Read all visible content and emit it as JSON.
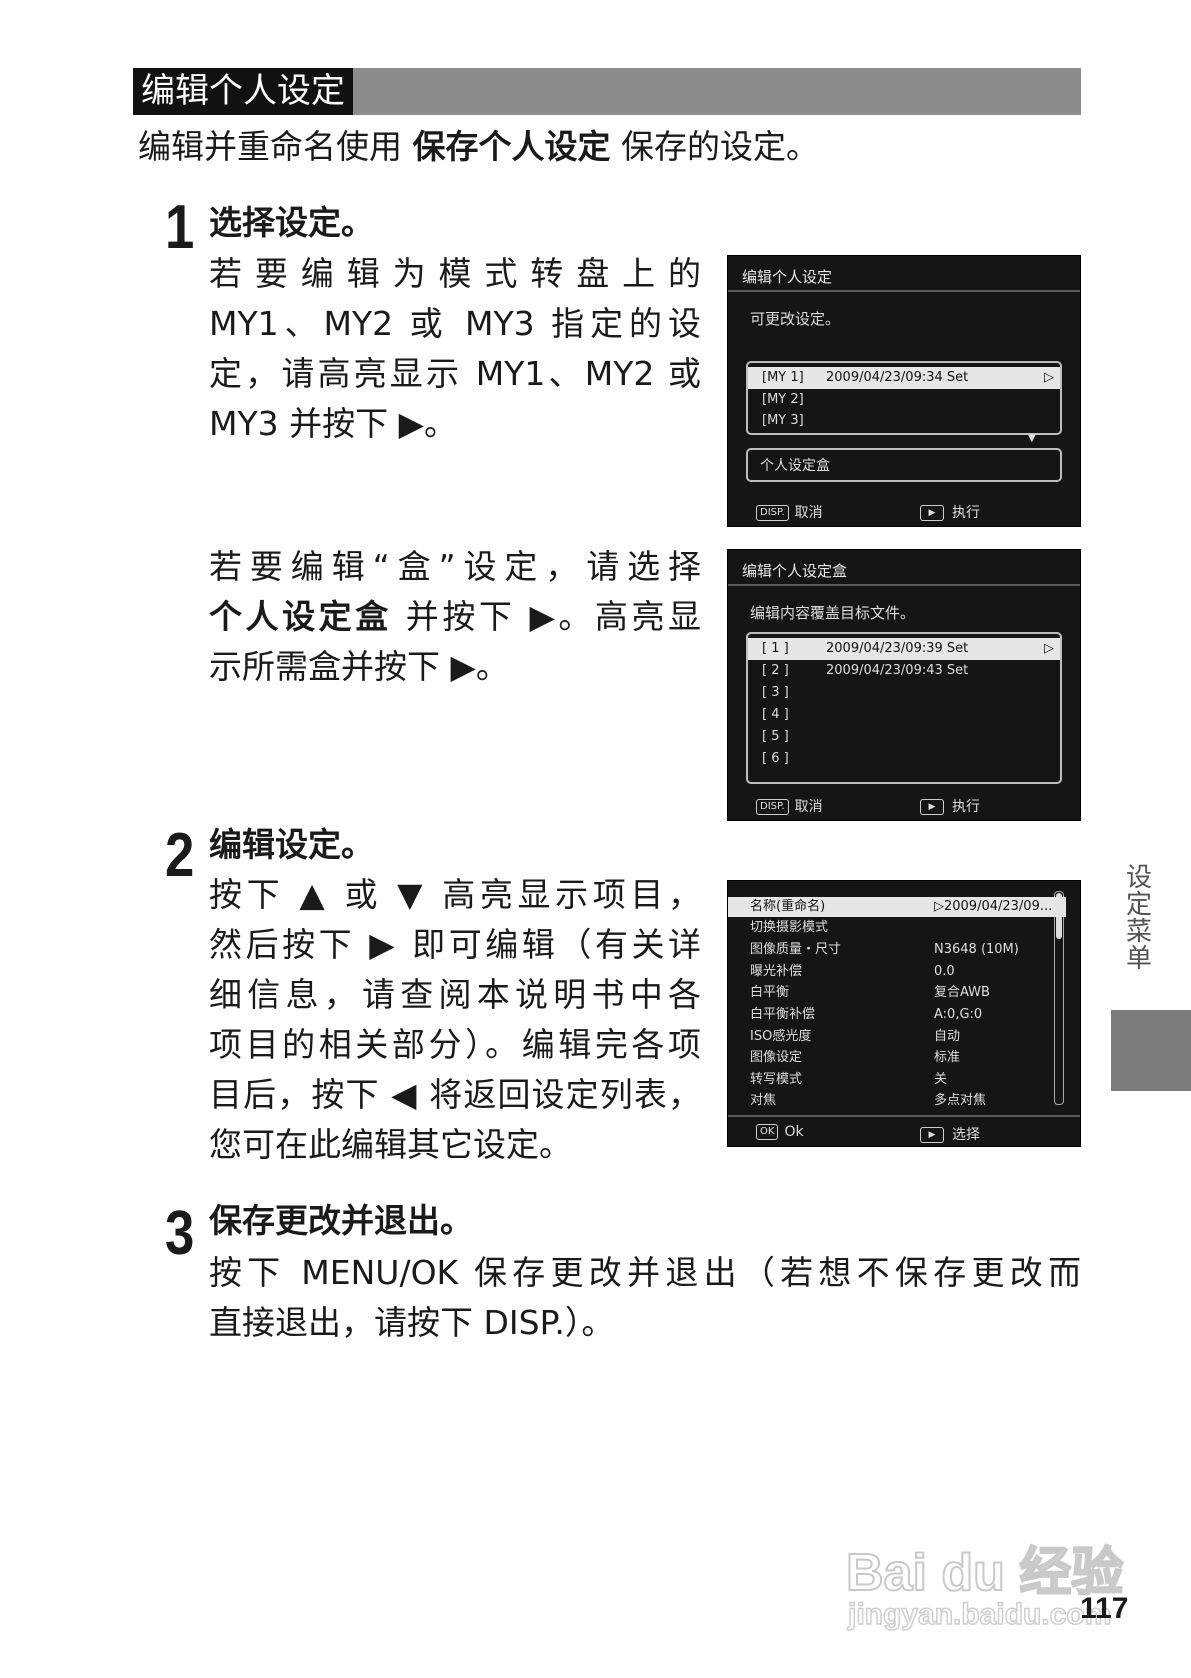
{
  "section": {
    "title": "编辑个人设定"
  },
  "intro": {
    "before": "编辑并重命名使用",
    "bold": "保存个人设定",
    "after": "保存的设定。"
  },
  "step1": {
    "num": "1",
    "title": "选择设定。",
    "para1": [
      "若要编辑为模式转盘上的",
      "MY1、MY2 或 MY3 指定的设",
      "定，请高亮显示 MY1、MY2 或",
      "MY3 并按下 ▶。"
    ],
    "para2_line1": "若要编辑“盒”设定，请选择",
    "para2_line2_bold": "个人设定盒",
    "para2_line2_rest": "并按下 ▶。高亮显",
    "para2_line3": "示所需盒并按下 ▶。"
  },
  "screen1": {
    "title": "编辑个人设定",
    "sub": "可更改设定。",
    "rows": [
      {
        "slot": "[MY 1]",
        "ts": "2009/04/23/09:34 Set",
        "arrow": "▷"
      },
      {
        "slot": "[MY 2]",
        "ts": "",
        "arrow": ""
      },
      {
        "slot": "[MY 3]",
        "ts": "",
        "arrow": ""
      }
    ],
    "scroll_marker": "▼",
    "box_item": "个人设定盒",
    "footer_key_left": "DISP.",
    "footer_left": "取消",
    "footer_key_right": "▶",
    "footer_right": "执行"
  },
  "screen2": {
    "title": "编辑个人设定盒",
    "sub": "编辑内容覆盖目标文件。",
    "rows": [
      {
        "slot": "[ 1 ]",
        "ts": "2009/04/23/09:39 Set",
        "arrow": "▷"
      },
      {
        "slot": "[ 2 ]",
        "ts": "2009/04/23/09:43 Set",
        "arrow": ""
      },
      {
        "slot": "[ 3 ]",
        "ts": "",
        "arrow": ""
      },
      {
        "slot": "[ 4 ]",
        "ts": "",
        "arrow": ""
      },
      {
        "slot": "[ 5 ]",
        "ts": "",
        "arrow": ""
      },
      {
        "slot": "[ 6 ]",
        "ts": "",
        "arrow": ""
      }
    ],
    "footer_key_left": "DISP.",
    "footer_left": "取消",
    "footer_key_right": "▶",
    "footer_right": "执行"
  },
  "step2": {
    "num": "2",
    "title": "编辑设定。",
    "para": [
      "按下 ▲ 或 ▼ 高亮显示项目，",
      "然后按下 ▶ 即可编辑（有关详",
      "细信息，请查阅本说明书中各",
      "项目的相关部分）。编辑完各项",
      "目后，按下 ◀ 将返回设定列表，",
      "您可在此编辑其它设定。"
    ]
  },
  "screen3": {
    "rows": [
      {
        "k": "名称(重命名)",
        "v": "▷2009/04/23/09..."
      },
      {
        "k": "切换摄影模式",
        "v": ""
      },
      {
        "k": "图像质量・尺寸",
        "v": "N3648 (10M)"
      },
      {
        "k": "曝光补偿",
        "v": "0.0"
      },
      {
        "k": "白平衡",
        "v": "复合AWB"
      },
      {
        "k": "白平衡补偿",
        "v": "A:0,G:0"
      },
      {
        "k": "ISO感光度",
        "v": "自动"
      },
      {
        "k": "图像设定",
        "v": "标准"
      },
      {
        "k": "转写模式",
        "v": "关"
      },
      {
        "k": "对焦",
        "v": "多点对焦"
      }
    ],
    "footer_key_left": "OK",
    "footer_left": "Ok",
    "footer_key_right": "▶",
    "footer_right": "选择"
  },
  "step3": {
    "num": "3",
    "title": "保存更改并退出。",
    "line1": "按下 MENU/OK 保存更改并退出（若想不保存更改而",
    "line2": "直接退出，请按下 DISP.）。"
  },
  "side": {
    "label": "设定菜单"
  },
  "page": {
    "number": "117"
  },
  "watermark": {
    "main": "Bai du 经验",
    "sub": "jingyan.baidu.com"
  }
}
